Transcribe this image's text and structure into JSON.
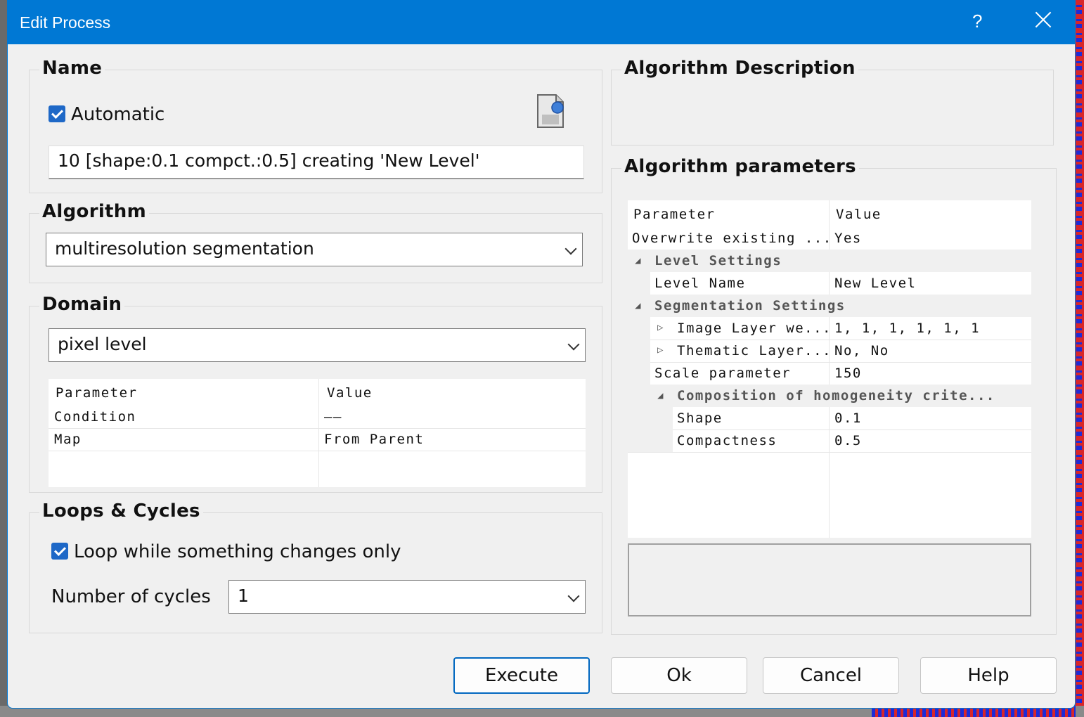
{
  "window": {
    "title": "Edit Process",
    "help_glyph": "?"
  },
  "name_group": {
    "legend": "Name",
    "automatic_label": "Automatic",
    "automatic_checked": true,
    "name_value": "10 [shape:0.1 compct.:0.5] creating 'New Level'"
  },
  "algorithm_group": {
    "legend": "Algorithm",
    "selected": "multiresolution segmentation"
  },
  "domain_group": {
    "legend": "Domain",
    "selected": "pixel level",
    "table": {
      "headers": [
        "Parameter",
        "Value"
      ],
      "rows": [
        {
          "param": "Condition",
          "value": "——"
        },
        {
          "param": "Map",
          "value": "From Parent"
        }
      ]
    }
  },
  "loops_group": {
    "legend": "Loops & Cycles",
    "loop_label": "Loop while something changes only",
    "loop_checked": true,
    "cycles_label": "Number of cycles",
    "cycles_value": "1"
  },
  "algorithm_description": {
    "legend": "Algorithm Description"
  },
  "algorithm_parameters": {
    "legend": "Algorithm parameters",
    "headers": [
      "Parameter",
      "Value"
    ],
    "rows": {
      "overwrite": {
        "param": "Overwrite existing ...",
        "value": "Yes"
      },
      "level_settings": {
        "label": "Level Settings"
      },
      "level_name": {
        "param": "Level Name",
        "value": "New Level"
      },
      "segmentation_settings": {
        "label": "Segmentation Settings"
      },
      "image_layer": {
        "param": "Image Layer we...",
        "value": "1, 1, 1, 1, 1, 1"
      },
      "thematic_layer": {
        "param": "Thematic Layer...",
        "value": "No, No"
      },
      "scale": {
        "param": "Scale parameter",
        "value": "150"
      },
      "composition": {
        "label": "Composition of homogeneity crite..."
      },
      "shape": {
        "param": "Shape",
        "value": "0.1"
      },
      "compactness": {
        "param": "Compactness",
        "value": "0.5"
      }
    }
  },
  "buttons": {
    "execute": "Execute",
    "ok": "Ok",
    "cancel": "Cancel",
    "help": "Help"
  }
}
